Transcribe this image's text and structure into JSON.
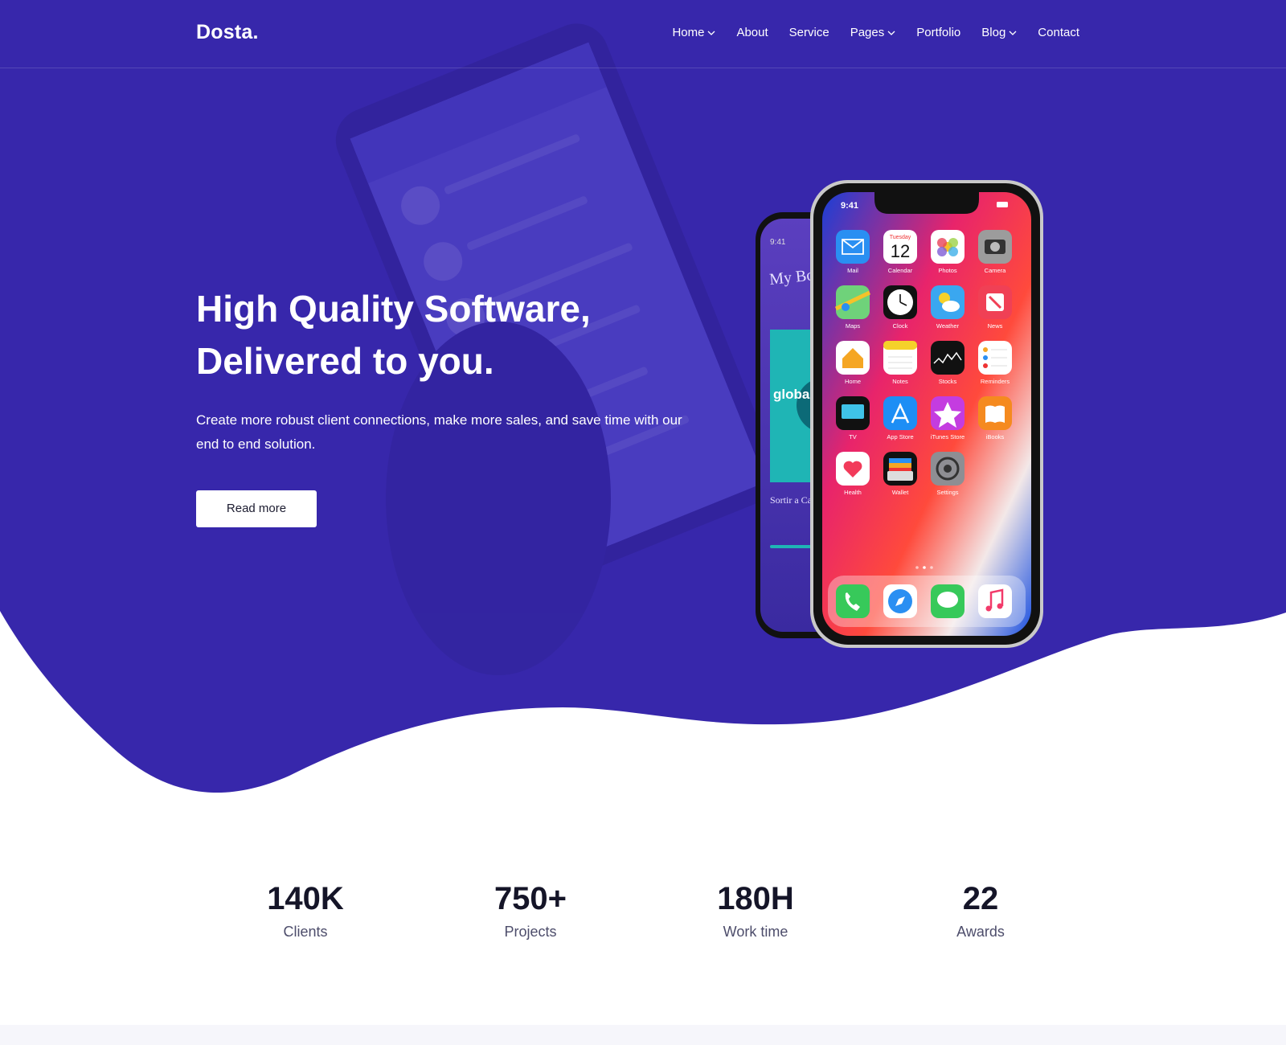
{
  "brand": {
    "logo": "Dosta."
  },
  "nav": {
    "items": [
      {
        "label": "Home",
        "has_dropdown": true
      },
      {
        "label": "About",
        "has_dropdown": false
      },
      {
        "label": "Service",
        "has_dropdown": false
      },
      {
        "label": "Pages",
        "has_dropdown": true
      },
      {
        "label": "Portfolio",
        "has_dropdown": false
      },
      {
        "label": "Blog",
        "has_dropdown": true
      },
      {
        "label": "Contact",
        "has_dropdown": false
      }
    ]
  },
  "hero": {
    "title_line1": "High Quality Software,",
    "title_line2": "Delivered to you.",
    "subtitle": "Create more robust client connections, make more sales, and save time with our end to end solution.",
    "cta_label": "Read more"
  },
  "phone": {
    "time": "9:41",
    "calendar_day": "Tuesday",
    "calendar_date": "12",
    "apps": [
      "Mail",
      "Calendar",
      "Photos",
      "Camera",
      "Maps",
      "Clock",
      "Weather",
      "News",
      "Home",
      "Notes",
      "Stocks",
      "Reminders",
      "TV",
      "App Store",
      "iTunes Store",
      "iBooks",
      "Health",
      "Wallet",
      "Settings"
    ],
    "dock": [
      "phone-icon",
      "safari-icon",
      "messages-icon",
      "music-icon"
    ],
    "back_phone": {
      "time": "9:41",
      "title": "My Books",
      "book_text": "global growth",
      "caption": "Sortir a Canne"
    }
  },
  "stats": [
    {
      "value": "140K",
      "label": "Clients"
    },
    {
      "value": "750+",
      "label": "Projects"
    },
    {
      "value": "180H",
      "label": "Work time"
    },
    {
      "value": "22",
      "label": "Awards"
    }
  ],
  "colors": {
    "hero": "#3727ab",
    "hero_overlay": "#4b3dc9",
    "text_dark": "#151528",
    "muted": "#4d4d6b"
  }
}
